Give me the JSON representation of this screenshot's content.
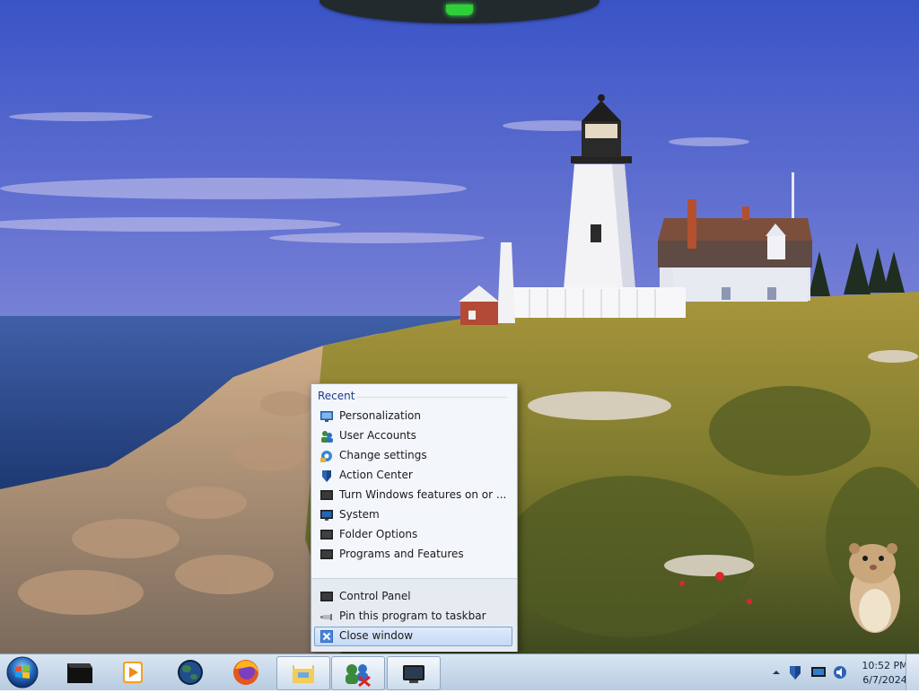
{
  "jump_list": {
    "section_title": "Recent",
    "items": [
      {
        "label": "Personalization"
      },
      {
        "label": "User Accounts"
      },
      {
        "label": "Change settings"
      },
      {
        "label": "Action Center"
      },
      {
        "label": "Turn Windows features on or ..."
      },
      {
        "label": "System"
      },
      {
        "label": "Folder Options"
      },
      {
        "label": "Programs and Features"
      }
    ],
    "tasks": [
      {
        "label": "Control Panel"
      },
      {
        "label": "Pin this program to taskbar"
      },
      {
        "label": "Close window"
      }
    ]
  },
  "taskbar": {
    "pinned": [
      {
        "icon": "black-app-icon"
      },
      {
        "icon": "media-player-icon"
      },
      {
        "icon": "globe-icon"
      },
      {
        "icon": "firefox-icon"
      },
      {
        "icon": "file-explorer-icon"
      },
      {
        "icon": "control-panel-icon"
      },
      {
        "icon": "monitor-icon"
      }
    ],
    "clock": {
      "time": "10:52 PM",
      "date": "6/7/2024"
    }
  },
  "colors": {
    "sky_top": "#3d57c4",
    "sea": "#2b4f93",
    "taskbar": "#c8d8ea",
    "menu_highlight": "#c5d9f7",
    "menu_title": "#1e3a8a"
  }
}
